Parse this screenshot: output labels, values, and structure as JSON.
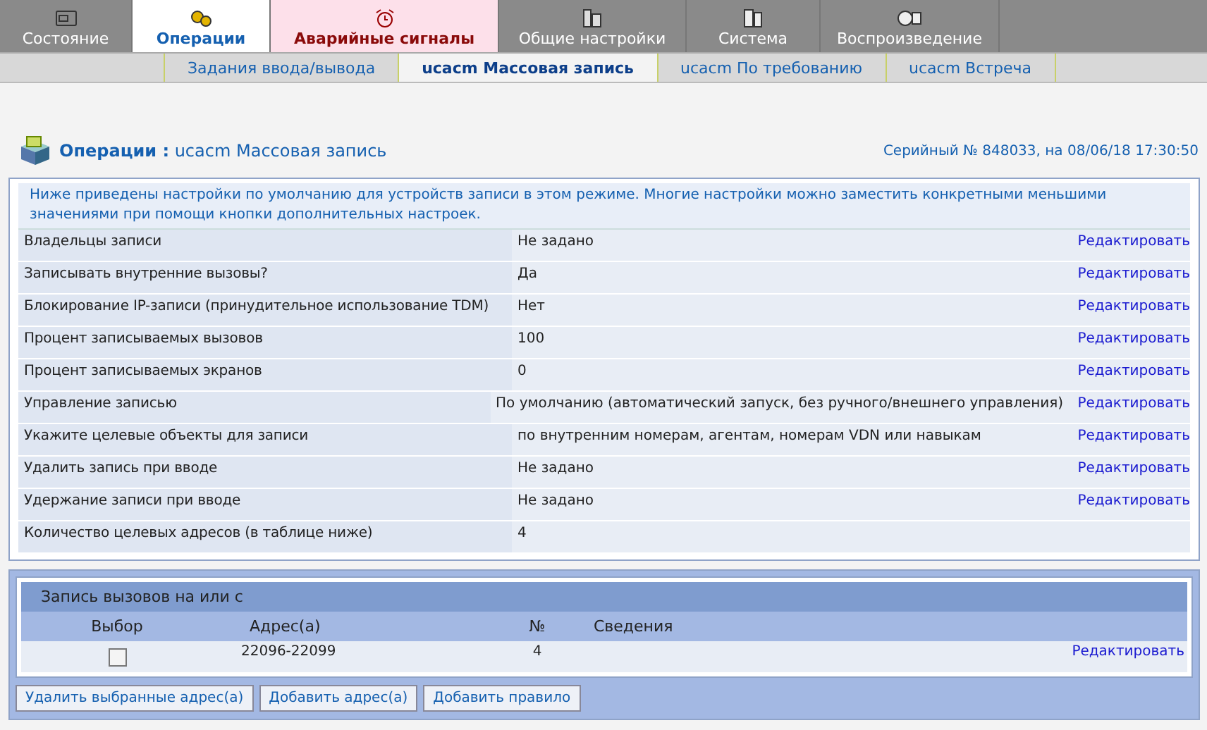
{
  "tabs": [
    {
      "label": "Состояние",
      "selected": false,
      "kind": "normal"
    },
    {
      "label": "Операции",
      "selected": true,
      "kind": "normal"
    },
    {
      "label": "Аварийные сигналы",
      "selected": false,
      "kind": "alarm"
    },
    {
      "label": "Общие настройки",
      "selected": false,
      "kind": "normal"
    },
    {
      "label": "Система",
      "selected": false,
      "kind": "normal"
    },
    {
      "label": "Воспроизведение",
      "selected": false,
      "kind": "normal"
    }
  ],
  "subtabs": [
    {
      "label": "Задания ввода/вывода",
      "selected": false
    },
    {
      "label": "ucacm Массовая запись",
      "selected": true
    },
    {
      "label": "ucacm По требованию",
      "selected": false
    },
    {
      "label": "ucacm Встреча",
      "selected": false
    }
  ],
  "header": {
    "section": "Операции :",
    "page": "ucacm Массовая запись",
    "serial": "Серийный № 848033, на 08/06/18 17:30:50"
  },
  "note": "Ниже приведены настройки по умолчанию для устройств записи в этом режиме. Многие настройки можно заместить конкретными меньшими значениями при помощи кнопки дополнительных настроек.",
  "settings": [
    {
      "label": "Владельцы записи",
      "value": "Не задано",
      "link": "Редактировать"
    },
    {
      "label": "Записывать внутренние вызовы?",
      "value": "Да",
      "link": "Редактировать"
    },
    {
      "label": "Блокирование IP-записи (принудительное использование TDM)",
      "value": "Нет",
      "link": "Редактировать"
    },
    {
      "label": "Процент записываемых вызовов",
      "value": "100",
      "link": "Редактировать"
    },
    {
      "label": "Процент записываемых экранов",
      "value": "0",
      "link": "Редактировать"
    },
    {
      "label": "Управление записью",
      "value": "По умолчанию (автоматический запуск, без ручного/внешнего управления)",
      "link": "Редактировать"
    },
    {
      "label": "Укажите целевые объекты для записи",
      "value": "по внутренним номерам, агентам, номерам VDN или навыкам",
      "link": "Редактировать"
    },
    {
      "label": "Удалить запись при вводе",
      "value": "Не задано",
      "link": "Редактировать"
    },
    {
      "label": "Удержание записи при вводе",
      "value": "Не задано",
      "link": "Редактировать"
    },
    {
      "label": "Количество целевых адресов (в таблице ниже)",
      "value": "4"
    }
  ],
  "addresses": {
    "title": "Запись вызовов на или с",
    "columns": [
      "Выбор",
      "Адрес(а)",
      "№",
      "Сведения"
    ],
    "rows": [
      {
        "checked": false,
        "address": "22096-22099",
        "count": "4",
        "link": "Редактировать"
      }
    ]
  },
  "buttons": [
    "Удалить выбранные адрес(а)",
    "Добавить адрес(а)",
    "Добавить правило"
  ]
}
